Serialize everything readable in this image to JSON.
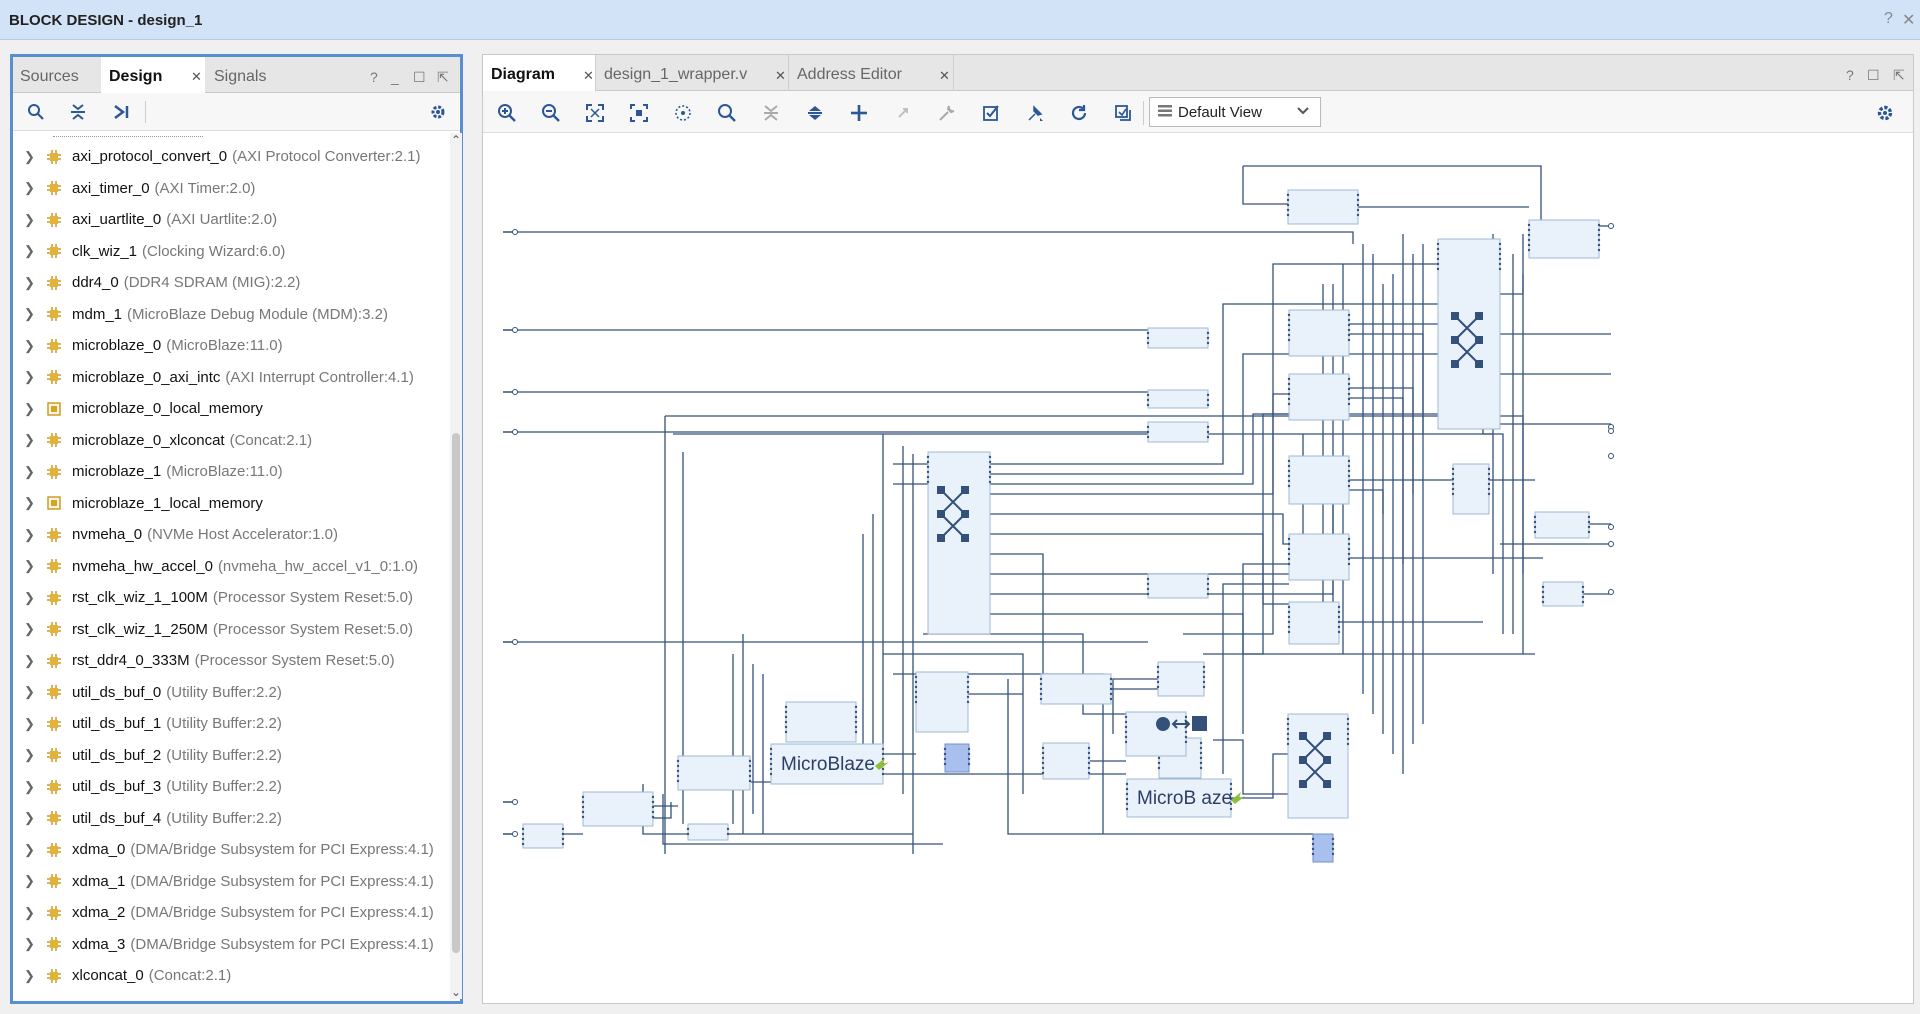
{
  "window": {
    "title": "BLOCK DESIGN - design_1"
  },
  "left_panel": {
    "tabs": [
      {
        "label": "Sources"
      },
      {
        "label": "Design"
      },
      {
        "label": "Signals"
      }
    ],
    "ctrl": {
      "help": "?",
      "minimize": "_",
      "maximize": "☐",
      "float": "⇱"
    },
    "tree_items": [
      {
        "name": "axi_protocol_convert_0",
        "type": "(AXI Protocol Converter:2.1)",
        "icon": "ip-core-icon"
      },
      {
        "name": "axi_timer_0",
        "type": "(AXI Timer:2.0)",
        "icon": "ip-core-icon"
      },
      {
        "name": "axi_uartlite_0",
        "type": "(AXI Uartlite:2.0)",
        "icon": "ip-core-icon"
      },
      {
        "name": "clk_wiz_1",
        "type": "(Clocking Wizard:6.0)",
        "icon": "ip-core-icon"
      },
      {
        "name": "ddr4_0",
        "type": "(DDR4 SDRAM (MIG):2.2)",
        "icon": "ip-core-icon"
      },
      {
        "name": "mdm_1",
        "type": "(MicroBlaze Debug Module (MDM):3.2)",
        "icon": "ip-core-icon"
      },
      {
        "name": "microblaze_0",
        "type": "(MicroBlaze:11.0)",
        "icon": "ip-core-icon"
      },
      {
        "name": "microblaze_0_axi_intc",
        "type": "(AXI Interrupt Controller:4.1)",
        "icon": "ip-core-icon"
      },
      {
        "name": "microblaze_0_local_memory",
        "type": "",
        "icon": "hierarchy-icon"
      },
      {
        "name": "microblaze_0_xlconcat",
        "type": "(Concat:2.1)",
        "icon": "ip-core-icon"
      },
      {
        "name": "microblaze_1",
        "type": "(MicroBlaze:11.0)",
        "icon": "ip-core-icon"
      },
      {
        "name": "microblaze_1_local_memory",
        "type": "",
        "icon": "hierarchy-icon"
      },
      {
        "name": "nvmeha_0",
        "type": "(NVMe Host Accelerator:1.0)",
        "icon": "ip-core-icon"
      },
      {
        "name": "nvmeha_hw_accel_0",
        "type": "(nvmeha_hw_accel_v1_0:1.0)",
        "icon": "ip-core-icon"
      },
      {
        "name": "rst_clk_wiz_1_100M",
        "type": "(Processor System Reset:5.0)",
        "icon": "ip-core-icon"
      },
      {
        "name": "rst_clk_wiz_1_250M",
        "type": "(Processor System Reset:5.0)",
        "icon": "ip-core-icon"
      },
      {
        "name": "rst_ddr4_0_333M",
        "type": "(Processor System Reset:5.0)",
        "icon": "ip-core-icon"
      },
      {
        "name": "util_ds_buf_0",
        "type": "(Utility Buffer:2.2)",
        "icon": "ip-core-icon"
      },
      {
        "name": "util_ds_buf_1",
        "type": "(Utility Buffer:2.2)",
        "icon": "ip-core-icon"
      },
      {
        "name": "util_ds_buf_2",
        "type": "(Utility Buffer:2.2)",
        "icon": "ip-core-icon"
      },
      {
        "name": "util_ds_buf_3",
        "type": "(Utility Buffer:2.2)",
        "icon": "ip-core-icon"
      },
      {
        "name": "util_ds_buf_4",
        "type": "(Utility Buffer:2.2)",
        "icon": "ip-core-icon"
      },
      {
        "name": "xdma_0",
        "type": "(DMA/Bridge Subsystem for PCI Express:4.1)",
        "icon": "ip-core-icon"
      },
      {
        "name": "xdma_1",
        "type": "(DMA/Bridge Subsystem for PCI Express:4.1)",
        "icon": "ip-core-icon"
      },
      {
        "name": "xdma_2",
        "type": "(DMA/Bridge Subsystem for PCI Express:4.1)",
        "icon": "ip-core-icon"
      },
      {
        "name": "xdma_3",
        "type": "(DMA/Bridge Subsystem for PCI Express:4.1)",
        "icon": "ip-core-icon"
      },
      {
        "name": "xlconcat_0",
        "type": "(Concat:2.1)",
        "icon": "ip-core-icon"
      }
    ]
  },
  "right_panel": {
    "tabs": [
      {
        "label": "Diagram"
      },
      {
        "label": "design_1_wrapper.v"
      },
      {
        "label": "Address Editor"
      }
    ],
    "view_selector": {
      "value": "Default View"
    },
    "diagram": {
      "block_labels": [
        "MicroBlaze",
        "MicroB aze"
      ]
    }
  },
  "colors": {
    "accent": "#5b8ed0",
    "title_bar": "#d3e3f7",
    "block_fill": "#e9f2fb",
    "wire": "#34517a",
    "icon": "#2b5797",
    "ip_core": "#d9a520"
  }
}
